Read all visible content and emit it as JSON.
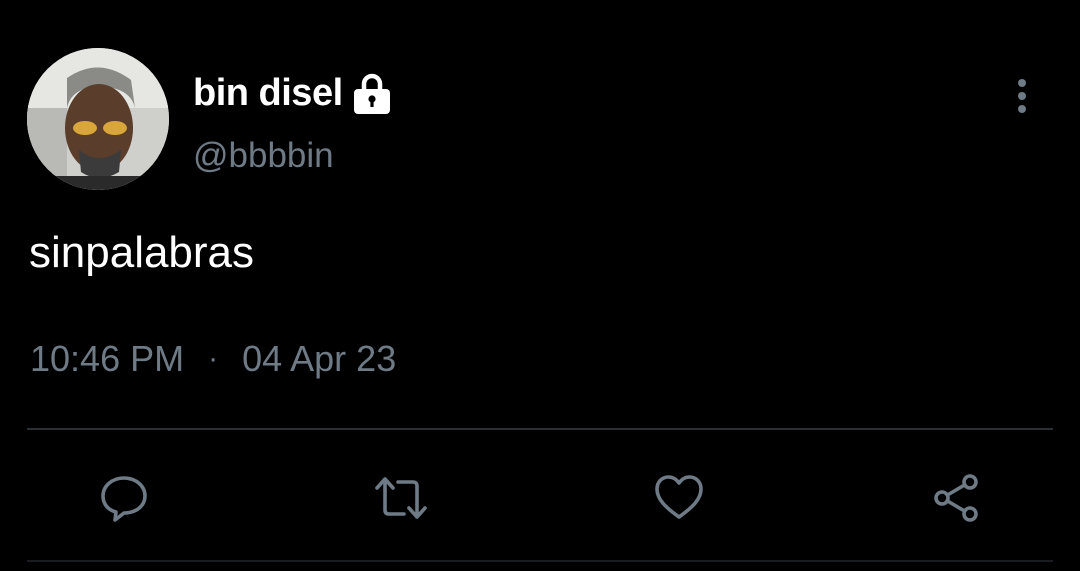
{
  "author": {
    "display_name": "bin disel",
    "handle": "@bbbbin",
    "protected_icon": "lock-icon",
    "avatar": "avatar-photo"
  },
  "tweet": {
    "text": "sinpalabras",
    "time": "10:46 PM",
    "separator": "·",
    "date": "04 Apr 23"
  },
  "menu_icon": "more-vertical-icon",
  "actions": [
    {
      "icon": "reply-icon"
    },
    {
      "icon": "retweet-icon"
    },
    {
      "icon": "like-icon"
    },
    {
      "icon": "share-icon"
    }
  ],
  "colors": {
    "background": "#000000",
    "primary_text": "#ffffff",
    "secondary_text": "#6e7a85",
    "divider": "#2a2f34"
  }
}
